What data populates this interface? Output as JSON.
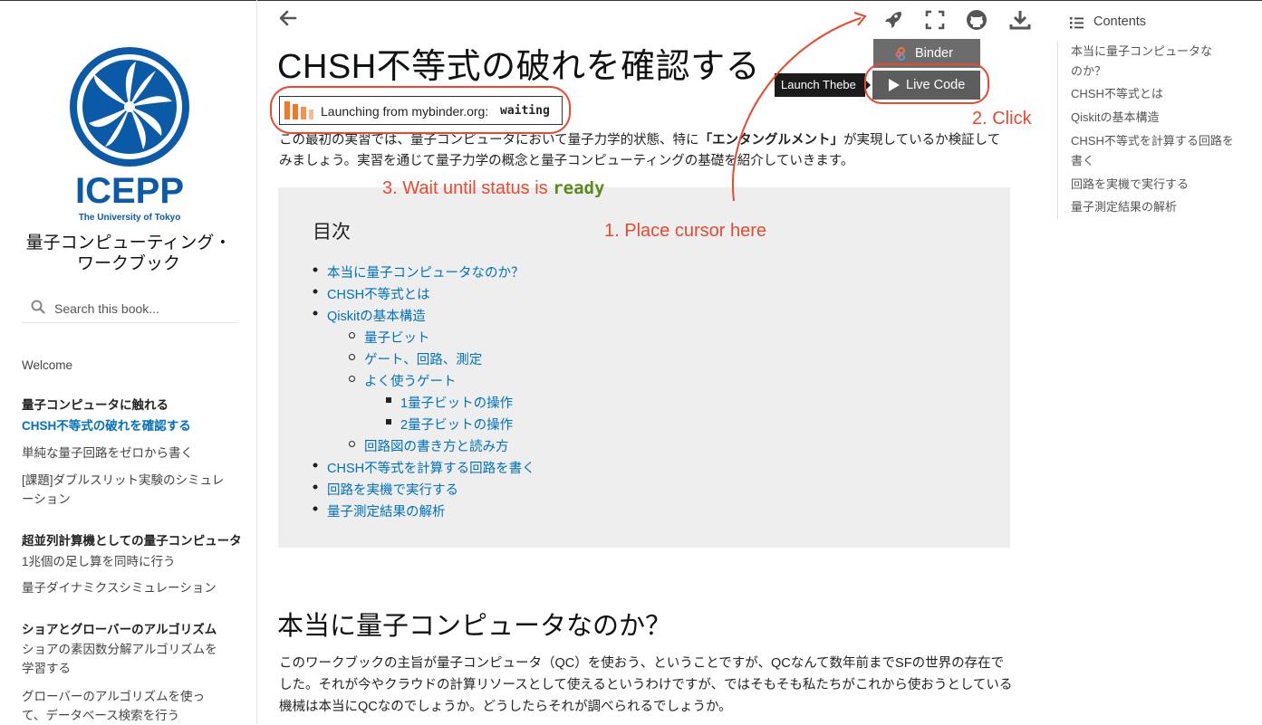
{
  "sidebar": {
    "logo_text": "ICEPP",
    "logo_subtext": "The University of Tokyo",
    "book_title": "量子コンピューティング・ワークブック",
    "search_placeholder": "Search this book...",
    "welcome": "Welcome",
    "sections": [
      {
        "caption": "量子コンピュータに触れる",
        "items": [
          "CHSH不等式の破れを確認する",
          "単純な量子回路をゼロから書く",
          "[課題]ダブルスリット実験のシミュレーション"
        ]
      },
      {
        "caption": "超並列計算機としての量子コンピュータ",
        "items": [
          "1兆個の足し算を同時に行う",
          "量子ダイナミクスシミュレーション"
        ]
      },
      {
        "caption": "ショアとグローバーのアルゴリズム",
        "items": [
          "ショアの素因数分解アルゴリズムを学習する",
          "グローバーのアルゴリズムを使って、データベース検索を行う"
        ]
      }
    ]
  },
  "header": {
    "back_icon": "back-arrow-icon",
    "title": "CHSH不等式の破れを確認する",
    "launch_text": "Launching from mybinder.org:",
    "launch_status": "waiting",
    "binder_label": "Binder",
    "live_code_label": "Live Code",
    "tooltip": "Launch Thebe"
  },
  "intro": {
    "part1": "この最初の実習では、量子コンピュータにおいて量子力学的状態、特に",
    "bold": "「エンタングルメント」",
    "part2": "が実現しているか検証してみましょう。実習を通じて量子力学の概念と量子コンピューティングの基礎を紹介していきます。"
  },
  "toc": {
    "title": "目次",
    "items": [
      "本当に量子コンピュータなのか？",
      "CHSH不等式とは",
      "Qiskitの基本構造",
      "量子ビット",
      "ゲート、回路、測定",
      "よく使うゲート",
      "1量子ビットの操作",
      "2量子ビットの操作",
      "回路図の書き方と読み方",
      "CHSH不等式を計算する回路を書く",
      "回路を実機で実行する",
      "量子測定結果の解析"
    ]
  },
  "section": {
    "heading": "本当に量子コンピュータなのか？",
    "paragraph": "このワークブックの主旨が量子コンピュータ（QC）を使おう、ということですが、QCなんて数年前までSFの世界の存在でした。それが今やクラウドの計算リソースとして使えるというわけですが、ではそもそも私たちがこれから使おうとしている機械は本当にQCなのでしょうか。どうしたらそれが調べられるでしょうか。"
  },
  "right_toc": {
    "heading": "Contents",
    "items": [
      "本当に量子コンピュータなのか？",
      "CHSH不等式とは",
      "Qiskitの基本構造",
      "CHSH不等式を計算する回路を書く",
      "回路を実機で実行する",
      "量子測定結果の解析"
    ]
  },
  "annotations": {
    "step1": "1. Place cursor here",
    "step2": "2. Click",
    "step3_prefix": "3. Wait until status is ",
    "step3_code": "ready"
  },
  "colors": {
    "link": "#0071bc",
    "annotation": "#e8492f",
    "logo": "#0b5aa8",
    "binder_orange": "#f37726",
    "ready_green": "#5a8a1e"
  }
}
